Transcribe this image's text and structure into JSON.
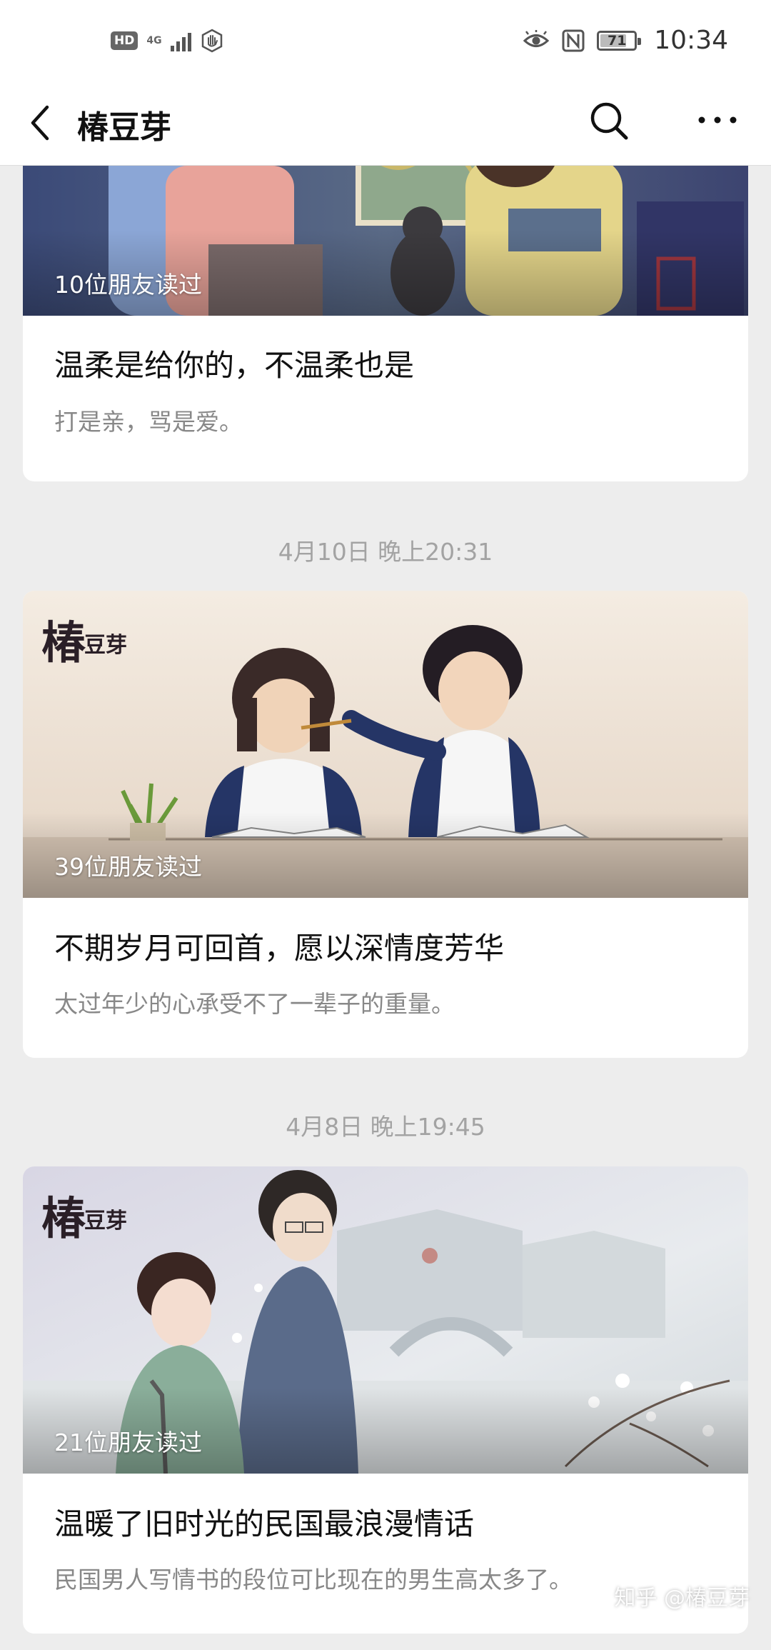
{
  "status_bar": {
    "hd_badge": "HD",
    "network": "4G",
    "time": "10:34",
    "battery": "71"
  },
  "header": {
    "title": "椿豆芽"
  },
  "feed": [
    {
      "read_count": "10位朋友读过",
      "title": "温柔是给你的，不温柔也是",
      "desc": "打是亲，骂是爱。"
    },
    {
      "timestamp": "4月10日 晚上20:31",
      "brand_big": "椿",
      "brand_small": "豆芽",
      "read_count": "39位朋友读过",
      "title": "不期岁月可回首，愿以深情度芳华",
      "desc": "太过年少的心承受不了一辈子的重量。"
    },
    {
      "timestamp": "4月8日 晚上19:45",
      "brand_big": "椿",
      "brand_small": "豆芽",
      "read_count": "21位朋友读过",
      "title": "温暖了旧时光的民国最浪漫情话",
      "desc": "民国男人写情书的段位可比现在的男生高太多了。"
    }
  ],
  "watermark": "知乎 @椿豆芽",
  "colors": {
    "page_bg": "#ededed",
    "card_bg": "#ffffff",
    "timestamp": "#a3a3a3",
    "desc": "#888888"
  }
}
